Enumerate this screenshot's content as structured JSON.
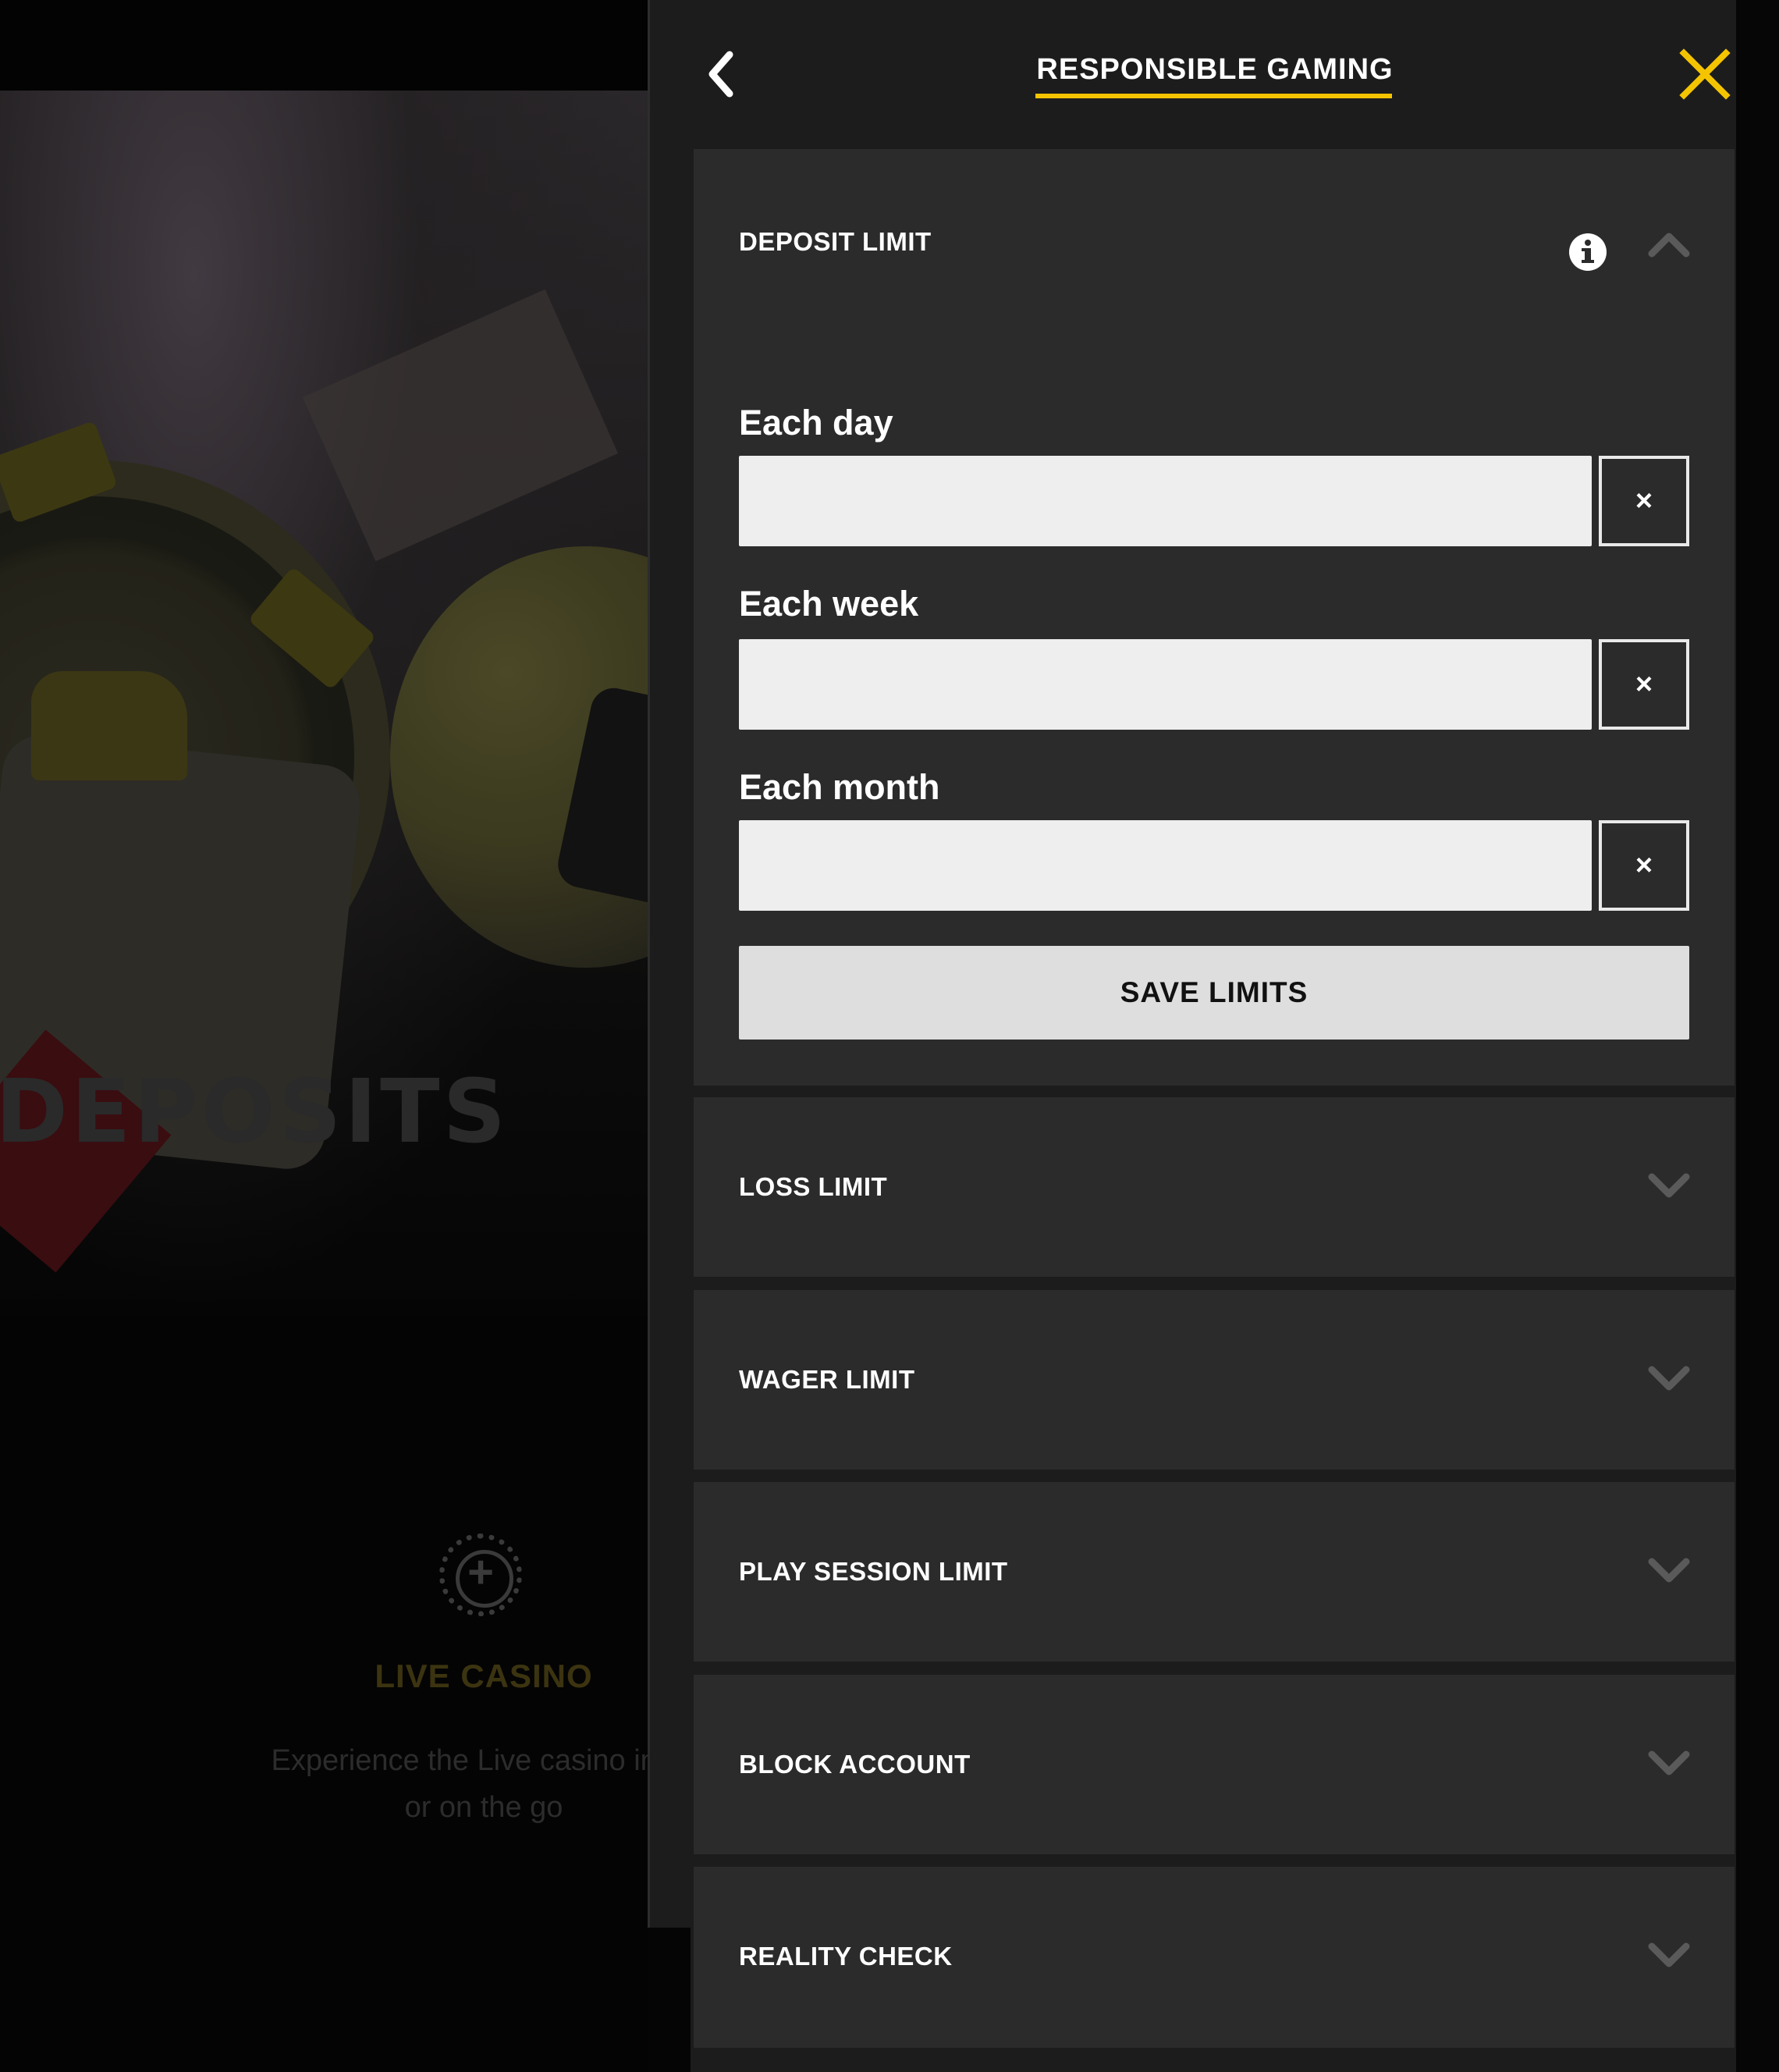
{
  "background_page": {
    "hero_word": "DEPOSITS",
    "live_casino": {
      "title": "LIVE CASINO",
      "description_line1": "Experience the Live casino in yo",
      "description_line2": "or on the go"
    }
  },
  "panel": {
    "title": "RESPONSIBLE GAMING",
    "accent_color": "#f5c400",
    "back_icon": "chevron-left-icon",
    "close_icon": "close-x-icon"
  },
  "deposit_limit": {
    "title": "DEPOSIT LIMIT",
    "expanded": true,
    "info_icon": "info-icon",
    "fields": [
      {
        "label": "Each day",
        "value": "",
        "clear_label": "×"
      },
      {
        "label": "Each week",
        "value": "",
        "clear_label": "×"
      },
      {
        "label": "Each month",
        "value": "",
        "clear_label": "×"
      }
    ],
    "save_label": "SAVE LIMITS"
  },
  "sections": [
    {
      "title": "LOSS LIMIT",
      "expanded": false
    },
    {
      "title": "WAGER LIMIT",
      "expanded": false
    },
    {
      "title": "PLAY SESSION LIMIT",
      "expanded": false
    },
    {
      "title": "BLOCK ACCOUNT",
      "expanded": false
    },
    {
      "title": "REALITY CHECK",
      "expanded": false
    }
  ]
}
